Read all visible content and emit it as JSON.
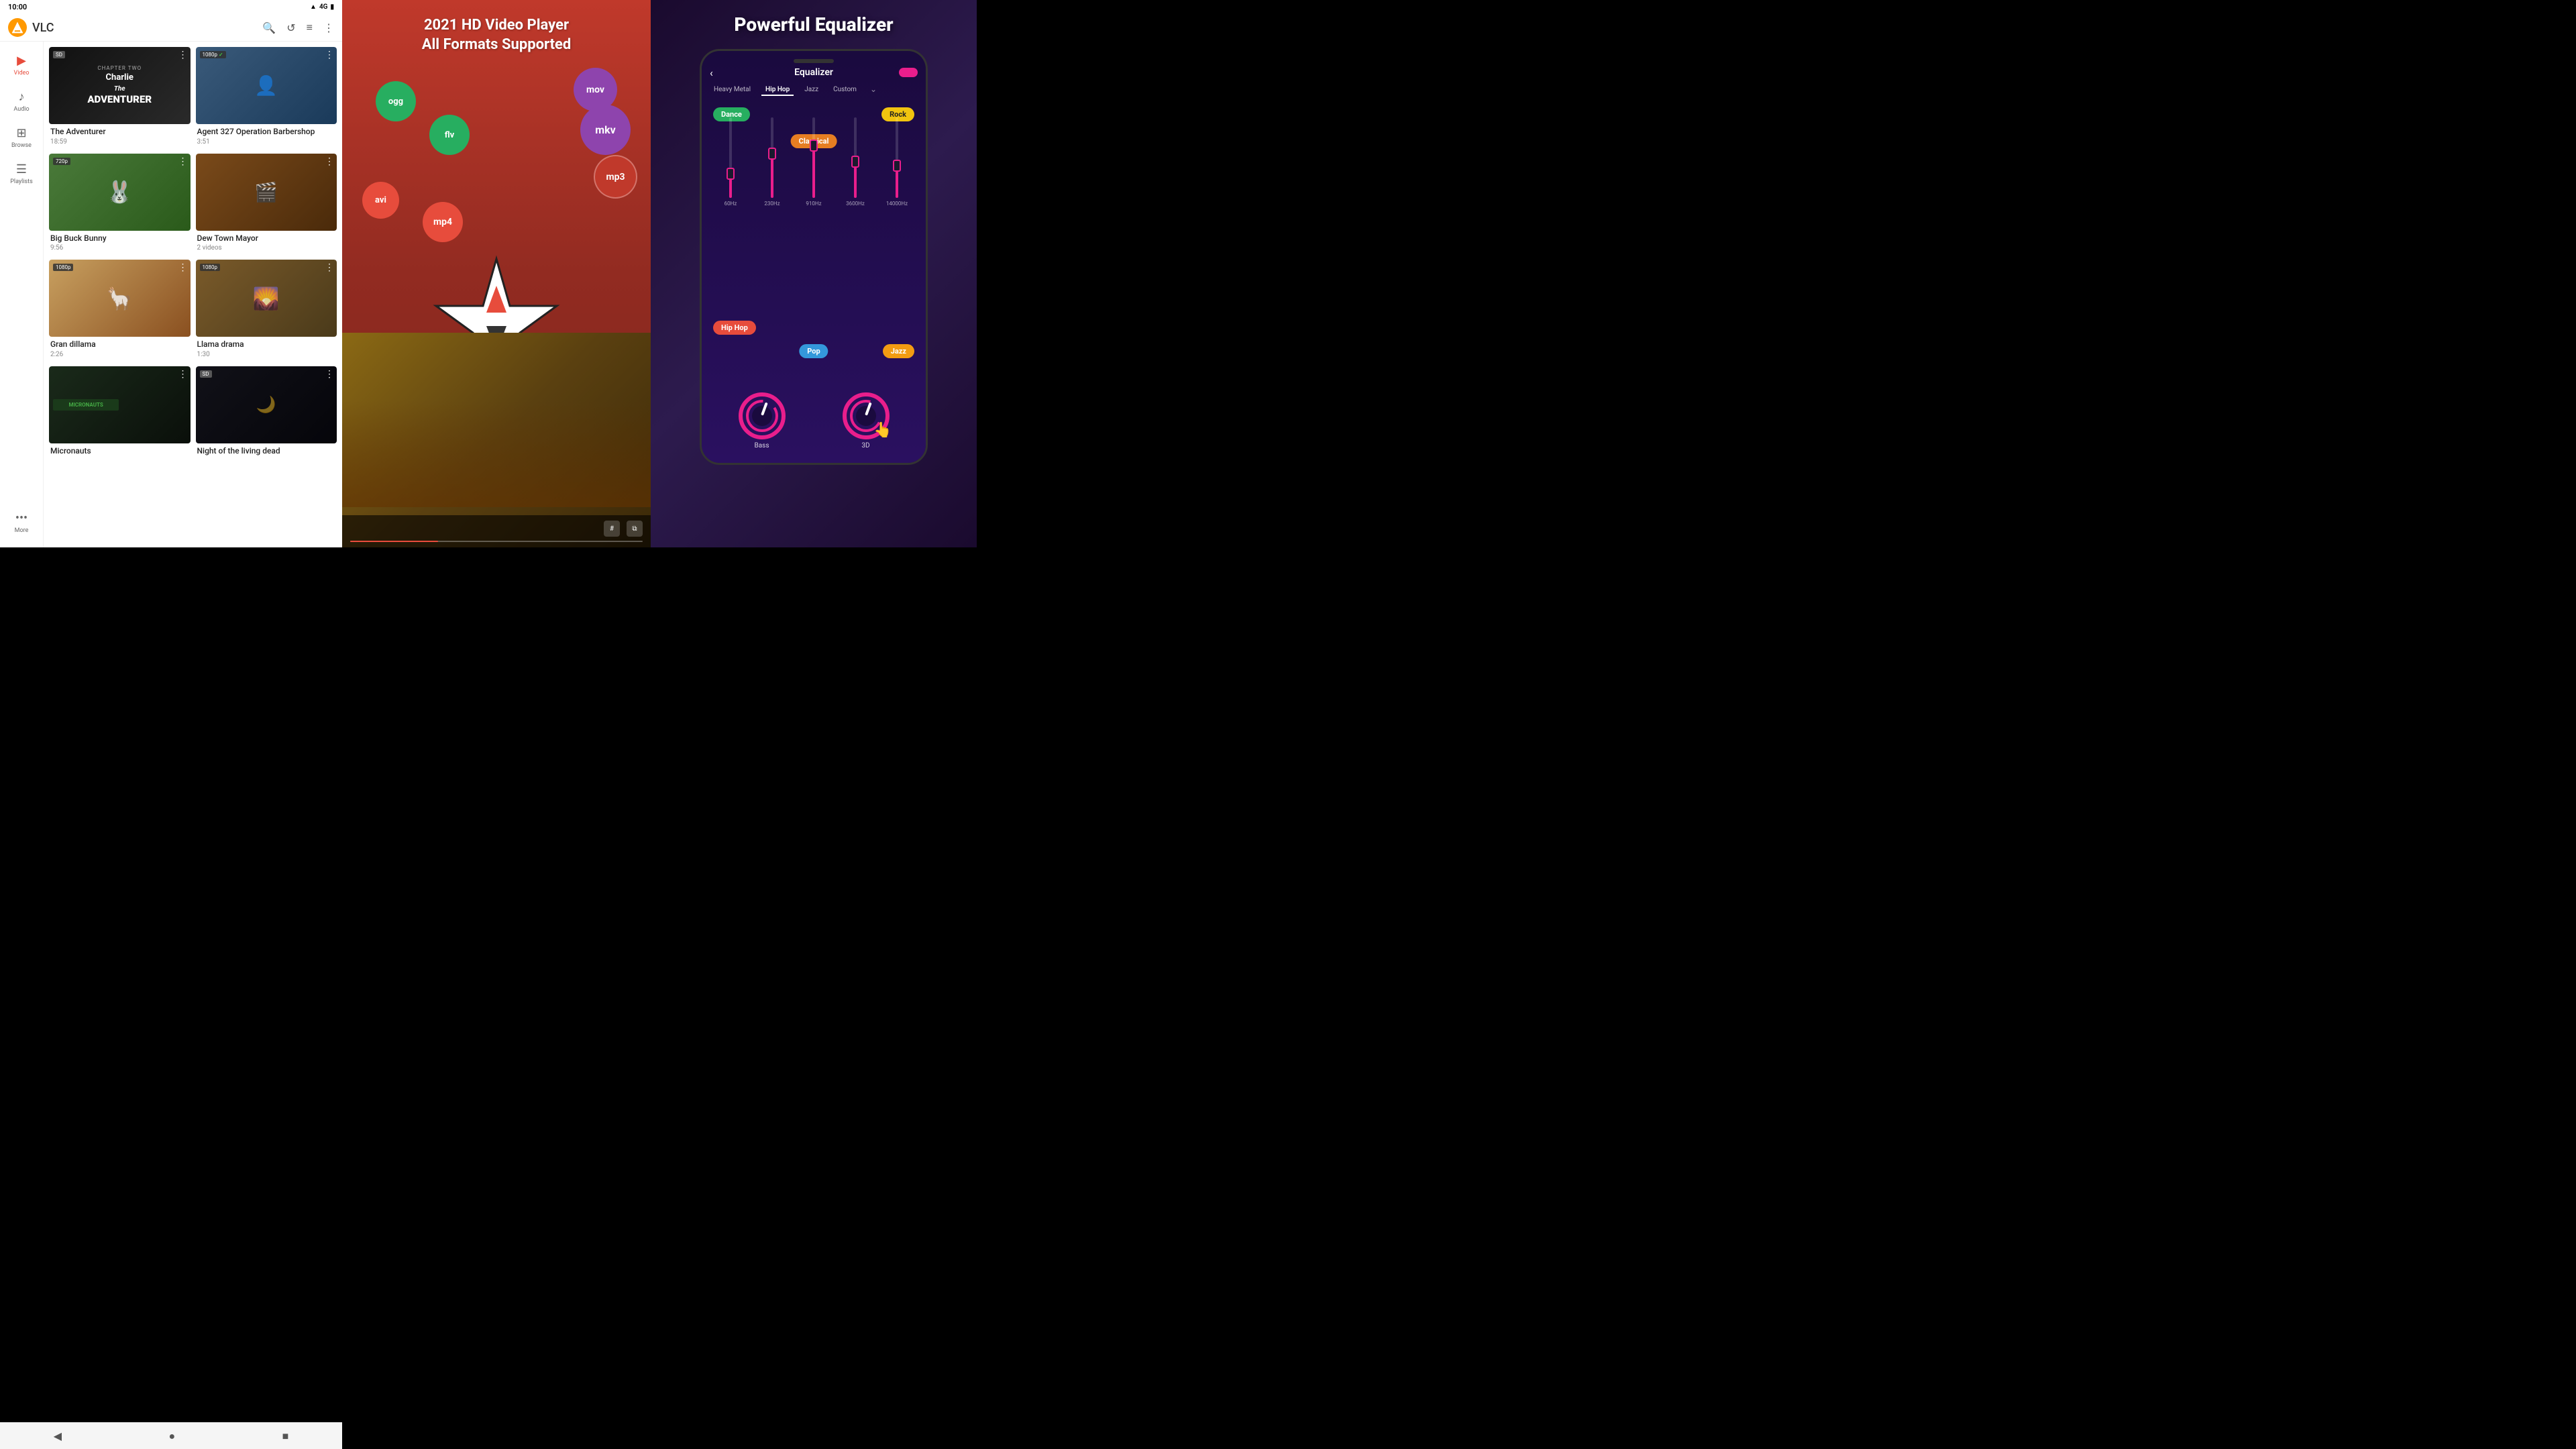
{
  "status_bar": {
    "time": "10:00",
    "signal": "4G",
    "battery": "full"
  },
  "vlc": {
    "title": "VLC",
    "header_icons": [
      "search",
      "history",
      "sort",
      "more"
    ],
    "nav_items": [
      {
        "id": "video",
        "label": "Video",
        "icon": "▶",
        "active": true
      },
      {
        "id": "audio",
        "label": "Audio",
        "icon": "♪",
        "active": false
      },
      {
        "id": "browse",
        "label": "Browse",
        "icon": "⊞",
        "active": false
      },
      {
        "id": "playlists",
        "label": "Playlists",
        "icon": "≡",
        "active": false
      },
      {
        "id": "more",
        "label": "More",
        "icon": "···",
        "active": false
      }
    ],
    "videos": [
      {
        "id": 1,
        "title": "The Adventurer",
        "duration": "18:59",
        "badge": "SD",
        "badge_type": "sd",
        "thumb_style": "adventurer",
        "has_menu": true
      },
      {
        "id": 2,
        "title": "Agent 327 Operation Barbershop",
        "duration": "3:51",
        "badge": "1080p",
        "badge_type": "hd-1080",
        "has_checkmark": true,
        "thumb_style": "agent",
        "has_menu": true
      },
      {
        "id": 3,
        "title": "Big Buck Bunny",
        "duration": "9:56",
        "badge": "720p",
        "badge_type": "hd-720",
        "thumb_style": "buck",
        "has_menu": true
      },
      {
        "id": 4,
        "title": "Dew Town Mayor",
        "duration": "",
        "sub": "2 videos",
        "badge": "",
        "badge_type": "folder",
        "thumb_style": "dew",
        "has_menu": true
      },
      {
        "id": 5,
        "title": "Gran dillama",
        "duration": "2:26",
        "badge": "1080p",
        "badge_type": "hd-1080",
        "thumb_style": "gran",
        "has_menu": true
      },
      {
        "id": 6,
        "title": "Llama drama",
        "duration": "1:30",
        "badge": "1080p",
        "badge_type": "hd-1080",
        "thumb_style": "llama",
        "has_menu": true
      },
      {
        "id": 7,
        "title": "Micronauts",
        "duration": "",
        "badge": "",
        "badge_type": "none",
        "thumb_style": "micro",
        "has_menu": true
      },
      {
        "id": 8,
        "title": "Night of the living dead",
        "duration": "",
        "badge": "SD",
        "badge_type": "sd",
        "thumb_style": "night",
        "has_menu": true
      }
    ],
    "android_nav": [
      "◀",
      "●",
      "■"
    ]
  },
  "middle_ad": {
    "title_line1": "2021 HD Video Player",
    "title_line2": "All Formats Supported",
    "formats": [
      "ogg",
      "mov",
      "flv",
      "mkv",
      "mp3",
      "avi",
      "mp4"
    ],
    "star_logo": true
  },
  "equalizer": {
    "title": "Powerful Equalizer",
    "header_title": "Equalizer",
    "presets": [
      "Heavy Metal",
      "Hip Hop",
      "Jazz",
      "Custom"
    ],
    "active_preset": "Hip Hop",
    "genres": [
      "Dance",
      "Rock",
      "Classical",
      "Jazz",
      "Hip Hop",
      "Pop"
    ],
    "sliders": [
      {
        "freq": "60Hz",
        "position": 0.3
      },
      {
        "freq": "230Hz",
        "position": 0.55
      },
      {
        "freq": "910Hz",
        "position": 0.65
      },
      {
        "freq": "3600Hz",
        "position": 0.45
      },
      {
        "freq": "14000Hz",
        "position": 0.4
      }
    ],
    "knobs": [
      {
        "label": "Bass"
      },
      {
        "label": "3D"
      }
    ]
  }
}
